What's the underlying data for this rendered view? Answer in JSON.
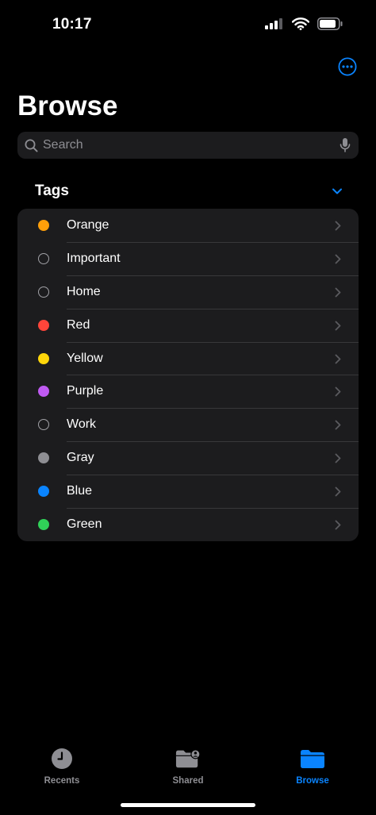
{
  "status_bar": {
    "time": "10:17"
  },
  "page": {
    "title": "Browse"
  },
  "search": {
    "placeholder": "Search"
  },
  "tags_section": {
    "title": "Tags",
    "items": [
      {
        "label": "Orange",
        "color": "#ff9f0a",
        "filled": true
      },
      {
        "label": "Important",
        "color": "",
        "filled": false
      },
      {
        "label": "Home",
        "color": "",
        "filled": false
      },
      {
        "label": "Red",
        "color": "#ff453a",
        "filled": true
      },
      {
        "label": "Yellow",
        "color": "#ffd60a",
        "filled": true
      },
      {
        "label": "Purple",
        "color": "#bf5af2",
        "filled": true
      },
      {
        "label": "Work",
        "color": "",
        "filled": false
      },
      {
        "label": "Gray",
        "color": "#8e8e93",
        "filled": true
      },
      {
        "label": "Blue",
        "color": "#0a84ff",
        "filled": true
      },
      {
        "label": "Green",
        "color": "#30d158",
        "filled": true
      }
    ]
  },
  "tab_bar": {
    "tabs": [
      {
        "label": "Recents",
        "icon": "clock-icon",
        "active": false
      },
      {
        "label": "Shared",
        "icon": "shared-folder-icon",
        "active": false
      },
      {
        "label": "Browse",
        "icon": "folder-icon",
        "active": true
      }
    ]
  },
  "colors": {
    "accent": "#0a84ff",
    "inactive": "#8e8e93",
    "background": "#000000",
    "card": "#1c1c1e"
  }
}
